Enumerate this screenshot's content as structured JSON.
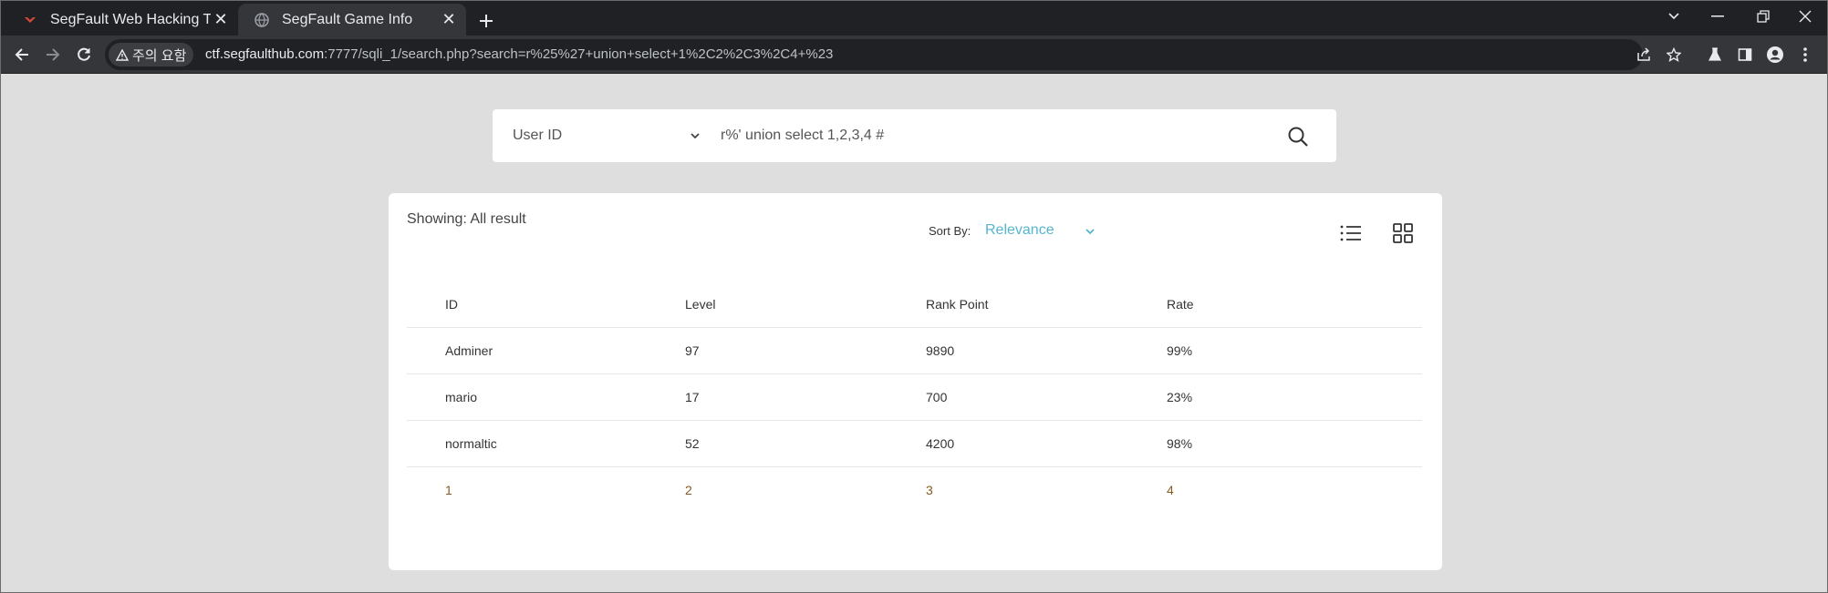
{
  "browser": {
    "tabs": [
      {
        "title": "SegFault Web Hacking Trai",
        "active": false
      },
      {
        "title": "SegFault Game Info",
        "active": true
      }
    ],
    "security_chip": "주의 요함",
    "url_host": "ctf.segfaulthub.com",
    "url_rest": ":7777/sqli_1/search.php?search=r%25%27+union+select+1%2C2%2C3%2C4+%23"
  },
  "search": {
    "select_value": "User ID",
    "query": "r%' union select 1,2,3,4 #"
  },
  "results": {
    "showing": "Showing: All result",
    "sort_label": "Sort By:",
    "sort_value": "Relevance",
    "columns": [
      "ID",
      "Level",
      "Rank Point",
      "Rate"
    ],
    "rows": [
      [
        "Adminer",
        "97",
        "9890",
        "99%"
      ],
      [
        "mario",
        "17",
        "700",
        "23%"
      ],
      [
        "normaltic",
        "52",
        "4200",
        "98%"
      ],
      [
        "1",
        "2",
        "3",
        "4"
      ]
    ]
  },
  "colors": {
    "accent": "#55b6cf",
    "page_bg": "#dedede",
    "chrome_dark": "#202124",
    "chrome_toolbar": "#35363a"
  }
}
